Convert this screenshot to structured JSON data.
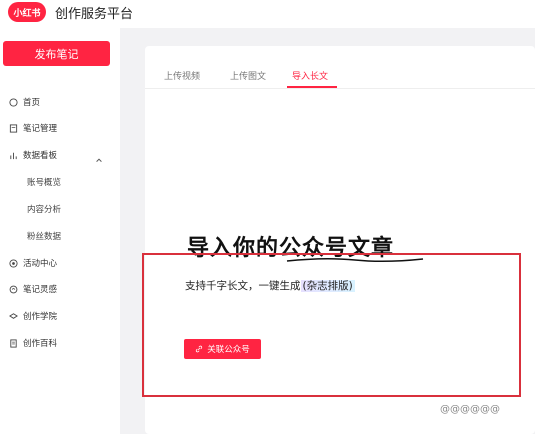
{
  "header": {
    "logo_text": "小红书",
    "app_title": "创作服务平台"
  },
  "sidebar": {
    "publish_label": "发布笔记",
    "items": [
      {
        "label": "首页",
        "icon": "home-icon"
      },
      {
        "label": "笔记管理",
        "icon": "note-icon"
      },
      {
        "label": "数据看板",
        "icon": "chart-icon"
      },
      {
        "label": "活动中心",
        "icon": "activity-icon"
      },
      {
        "label": "笔记灵感",
        "icon": "inspiration-icon"
      },
      {
        "label": "创作学院",
        "icon": "academy-icon"
      },
      {
        "label": "创作百科",
        "icon": "encyclopedia-icon"
      }
    ],
    "sub_items": [
      "账号概览",
      "内容分析",
      "粉丝数据"
    ]
  },
  "tabs": [
    {
      "label": "上传视频",
      "active": false
    },
    {
      "label": "上传图文",
      "active": false
    },
    {
      "label": "导入长文",
      "active": true
    }
  ],
  "content": {
    "title": "导入你的公众号文章",
    "subtitle_prefix": "支持千字长文，一键生成",
    "subtitle_highlight": "(杂志排版)",
    "link_button": "关联公众号"
  },
  "watermark": "@@@@@@",
  "colors": {
    "brand": "#ff2442",
    "background": "#f2f2f4",
    "annotation_box": "#d9303c"
  }
}
